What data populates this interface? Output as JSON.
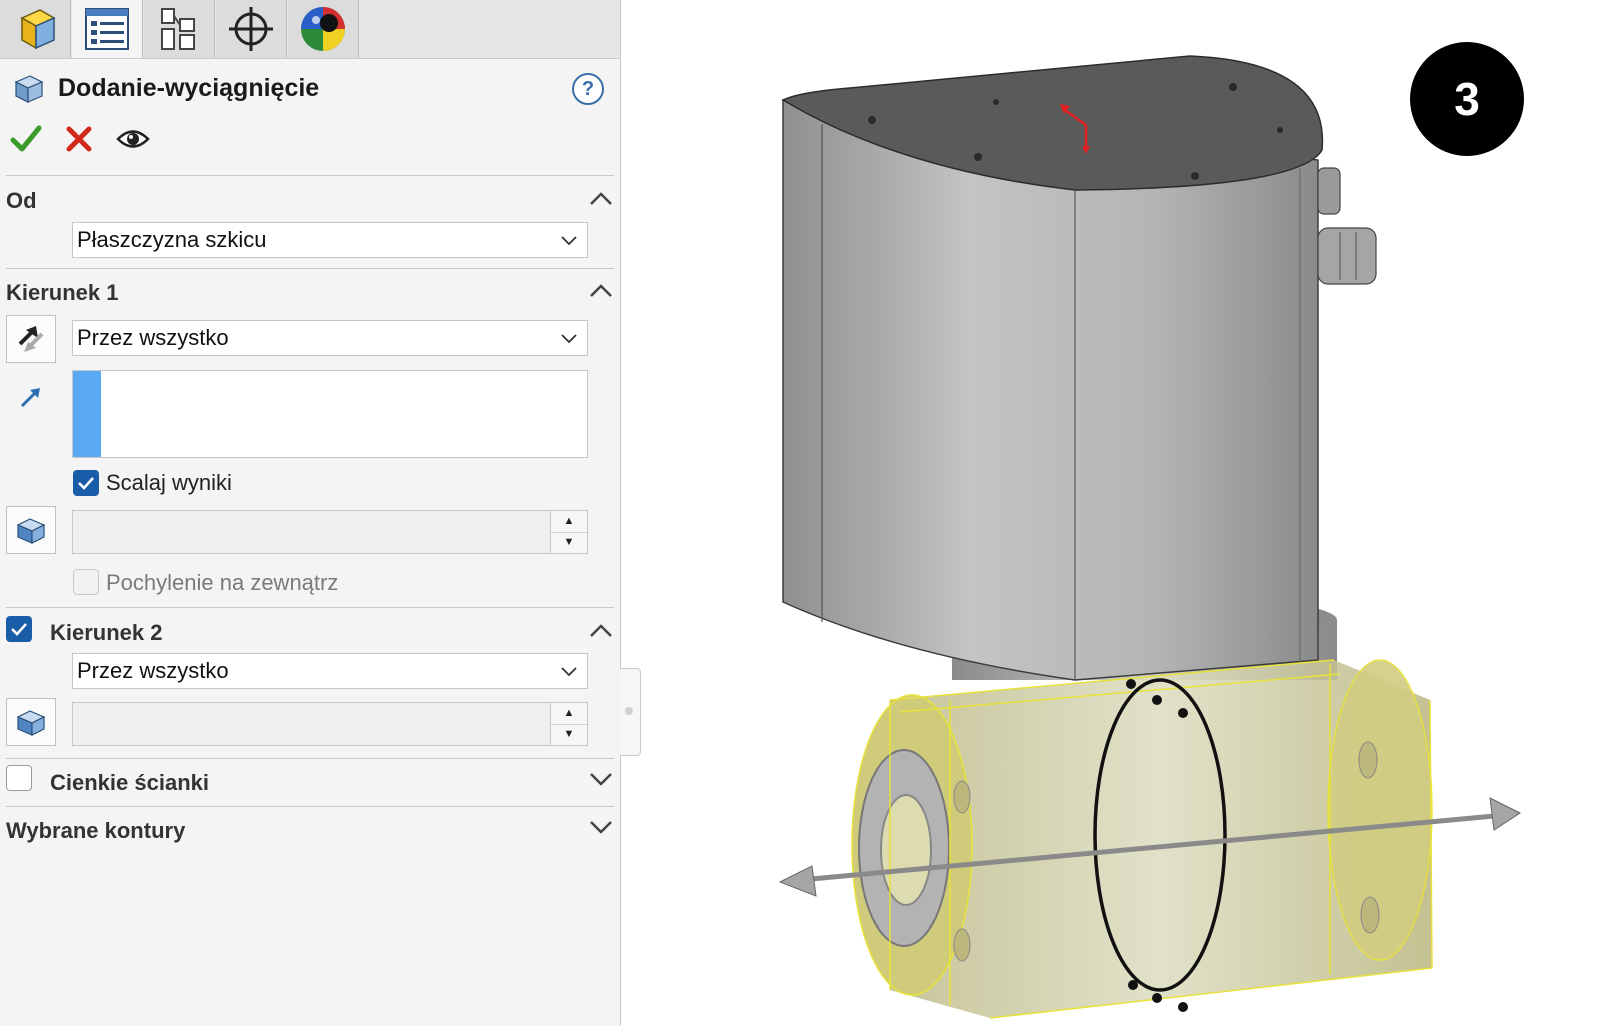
{
  "tabs": [
    {
      "name": "feature-manager-tab",
      "icon": "feature-manager-icon"
    },
    {
      "name": "property-manager-tab",
      "icon": "property-manager-icon"
    },
    {
      "name": "configuration-manager-tab",
      "icon": "configuration-manager-icon"
    },
    {
      "name": "dimxpert-manager-tab",
      "icon": "crosshair-icon"
    },
    {
      "name": "display-manager-tab",
      "icon": "appearance-sphere-icon"
    }
  ],
  "feature": {
    "title": "Dodanie-wyciągnięcie",
    "help": "?"
  },
  "actions": {
    "ok": "confirm-check-icon",
    "cancel": "cancel-x-icon",
    "preview": "preview-eye-icon"
  },
  "from": {
    "title": "Od",
    "value": "Płaszczyzna szkicu"
  },
  "direction1": {
    "title": "Kierunek 1",
    "end_condition": "Przez wszystko",
    "merge_label": "Scalaj wyniki",
    "merge_checked": true,
    "draft_label": "Pochylenie na zewnątrz",
    "draft_checked": false
  },
  "direction2": {
    "title": "Kierunek 2",
    "checked": true,
    "end_condition": "Przez wszystko"
  },
  "thin": {
    "title": "Cienkie ścianki",
    "checked": false
  },
  "contours": {
    "title": "Wybrane kontury"
  },
  "badge": "3",
  "colors": {
    "accent": "#1a5ca8",
    "selection": "#5aa9f5",
    "ok": "#3a9a2a",
    "cancel": "#d22a1a",
    "preview_yellow": "#e8e23a"
  }
}
